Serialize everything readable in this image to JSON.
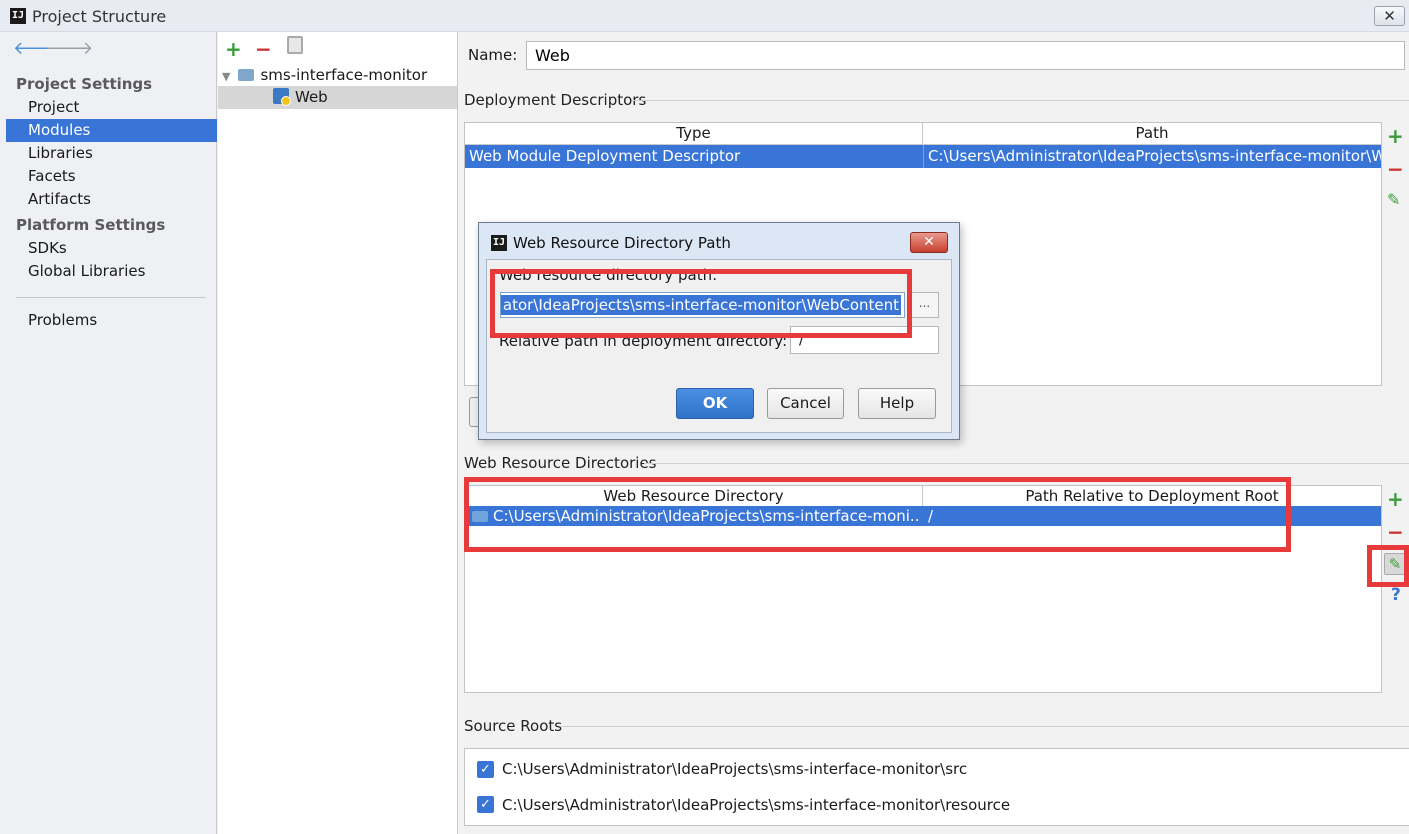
{
  "window": {
    "title": "Project Structure",
    "close": "✕",
    "logo": "IJ"
  },
  "sidebar": {
    "back_icon": "🡐",
    "forward_icon": "🡒",
    "project_settings_header": "Project Settings",
    "project_items": [
      "Project",
      "Modules",
      "Libraries",
      "Facets",
      "Artifacts"
    ],
    "platform_settings_header": "Platform Settings",
    "platform_items": [
      "SDKs",
      "Global Libraries"
    ],
    "problems": "Problems",
    "selected": "Modules"
  },
  "tree": {
    "add": "+",
    "remove": "−",
    "root": "sms-interface-monitor",
    "child": "Web",
    "expand": "▼"
  },
  "main": {
    "name_label": "Name:",
    "name_value": "Web",
    "deployment_title": "Deployment Descriptors",
    "deployment_headers": [
      "Type",
      "Path"
    ],
    "deployment_row": {
      "type": "Web Module Deployment Descriptor",
      "path": "C:\\Users\\Administrator\\IdeaProjects\\sms-interface-monitor\\W"
    },
    "web_resource_title": "Web Resource Directories",
    "web_resource_headers": [
      "Web Resource Directory",
      "Path Relative to Deployment Root"
    ],
    "web_resource_row": {
      "dir": "C:\\Users\\Administrator\\IdeaProjects\\sms-interface-moni...",
      "path": "/"
    },
    "source_roots_title": "Source Roots",
    "source_roots": [
      "C:\\Users\\Administrator\\IdeaProjects\\sms-interface-monitor\\src",
      "C:\\Users\\Administrator\\IdeaProjects\\sms-interface-monitor\\resource"
    ],
    "side_add": "+",
    "side_remove": "−",
    "side_edit": "✎",
    "side_help": "?"
  },
  "dialog": {
    "logo": "IJ",
    "title": "Web Resource Directory Path",
    "close": "✕",
    "path_label": "Web resource directory path:",
    "path_value": "ator\\IdeaProjects\\sms-interface-monitor\\WebContent",
    "browse": "...",
    "relative_label": "Relative path in deployment directory:",
    "relative_value": "/",
    "ok": "OK",
    "cancel": "Cancel",
    "help": "Help"
  },
  "colors": {
    "selection": "#3875d7",
    "annotation": "#e83a3a",
    "add": "#3a9d3a",
    "remove": "#cc3333"
  }
}
